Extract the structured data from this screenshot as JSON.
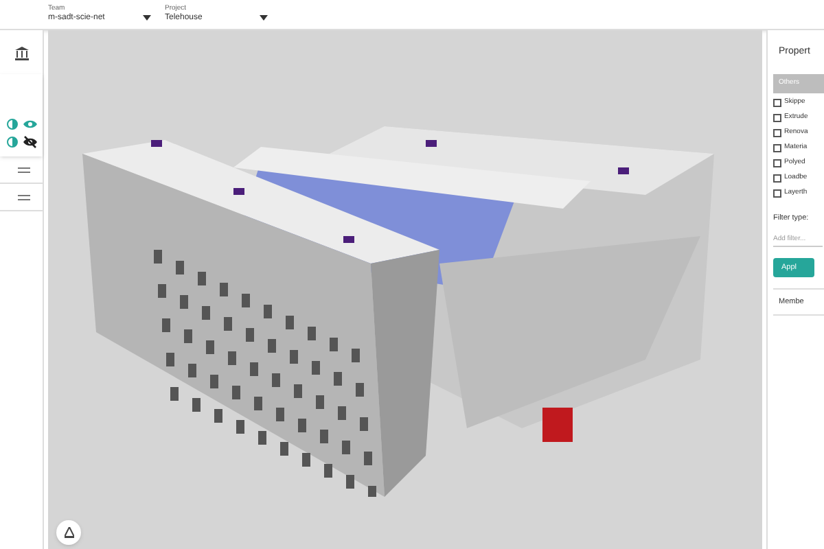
{
  "top_bar": {
    "team": {
      "label": "Team",
      "value": "m-sadt-scie-net"
    },
    "project": {
      "label": "Project",
      "value": "Telehouse"
    }
  },
  "layers": [
    {
      "visible": true
    },
    {
      "visible": false
    }
  ],
  "properties_panel": {
    "title": "Propert",
    "tab": "Others",
    "filters": [
      {
        "label": "Skippe",
        "checked": false
      },
      {
        "label": "Extrude",
        "checked": false
      },
      {
        "label": "Renova",
        "checked": false
      },
      {
        "label": "Materia",
        "checked": false
      },
      {
        "label": "Polyed",
        "checked": false
      },
      {
        "label": "Loadbe",
        "checked": false
      },
      {
        "label": "Layerth",
        "checked": false
      }
    ],
    "filter_type_label": "Filter type:",
    "filter_placeholder": "Add filter...",
    "apply_button": "Appl",
    "members": "Membe"
  }
}
